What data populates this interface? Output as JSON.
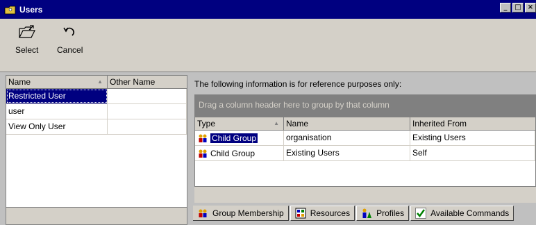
{
  "window": {
    "title": "Users",
    "minimize": "_",
    "maximize": "□",
    "close": "×"
  },
  "toolbar": {
    "select_label": "Select",
    "cancel_label": "Cancel"
  },
  "users_table": {
    "headers": [
      "Name",
      "Other Name"
    ],
    "rows": [
      {
        "name": "Restricted User",
        "other": ""
      },
      {
        "name": "user",
        "other": ""
      },
      {
        "name": "View Only User",
        "other": ""
      }
    ],
    "selected_index": 0
  },
  "info": {
    "text": "The following information is for reference purposes only:",
    "group_hint": "Drag a column header here to group by that column"
  },
  "details_table": {
    "headers": [
      "Type",
      "Name",
      "Inherited From"
    ],
    "rows": [
      {
        "type": "Child Group",
        "name": "organisation",
        "inherited": "Existing Users"
      },
      {
        "type": "Child Group",
        "name": "Existing Users",
        "inherited": "Self"
      }
    ]
  },
  "tabs": [
    {
      "label": "Group Membership",
      "icon": "group-icon"
    },
    {
      "label": "Resources",
      "icon": "resources-icon"
    },
    {
      "label": "Profiles",
      "icon": "profiles-icon"
    },
    {
      "label": "Available Commands",
      "icon": "checkmark-icon"
    }
  ]
}
